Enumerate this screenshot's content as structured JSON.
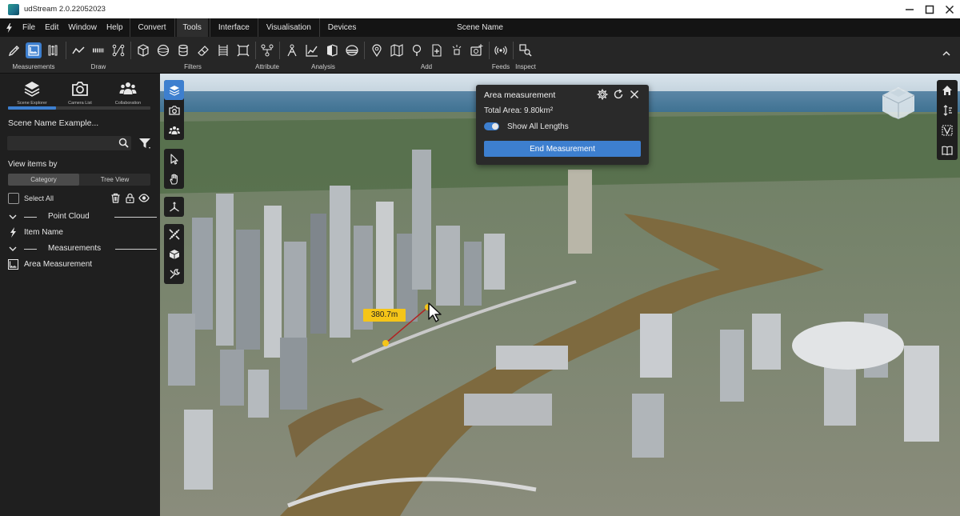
{
  "window": {
    "title": "udStream 2.0.22052023",
    "controls": [
      "minimize-icon",
      "maximize-icon",
      "close-icon"
    ]
  },
  "menubar": {
    "items": [
      "File",
      "Edit",
      "Window",
      "Help"
    ],
    "tabs": [
      "Convert",
      "Tools",
      "Interface",
      "Visualisation",
      "Devices"
    ],
    "active_tab": "Tools",
    "scene_name": "Scene Name"
  },
  "toolbar": {
    "groups": [
      {
        "label": "Measurements",
        "icons": [
          "ruler-pencil-icon",
          "area-measure-icon",
          "height-measure-icon"
        ]
      },
      {
        "label": "Draw",
        "icons": [
          "polyline-icon",
          "dashed-line-icon",
          "node-link-icon"
        ]
      },
      {
        "label": "Filters",
        "icons": [
          "box-filter-icon",
          "sphere-filter-icon",
          "cylinder-filter-icon",
          "eraser-icon",
          "cross-section-icon",
          "cube-select-icon"
        ]
      },
      {
        "label": "Attribute",
        "icons": [
          "attribute-tree-icon"
        ]
      },
      {
        "label": "Analysis",
        "icons": [
          "line-of-sight-icon",
          "chart-icon",
          "viewshed-icon",
          "flood-icon"
        ]
      },
      {
        "label": "Add",
        "icons": [
          "pin-icon",
          "map-icon",
          "poi-icon",
          "add-file-icon",
          "lamp-icon",
          "add-image-icon"
        ]
      },
      {
        "label": "Feeds",
        "icons": [
          "broadcast-icon"
        ]
      },
      {
        "label": "Inspect",
        "icons": [
          "inspect-icon"
        ]
      }
    ]
  },
  "sidebar": {
    "tabs": [
      {
        "label": "Scene Explorer",
        "icon": "layers-icon",
        "active": true
      },
      {
        "label": "Camera List",
        "icon": "camera-icon",
        "active": false
      },
      {
        "label": "Collaboration",
        "icon": "users-icon",
        "active": false
      }
    ],
    "scene_title": "Scene Name Example...",
    "search_placeholder": "",
    "view_by_label": "View items by",
    "view_modes": [
      "Category",
      "Tree View"
    ],
    "active_view_mode": "Category",
    "select_all_label": "Select All",
    "tree": [
      {
        "type": "group",
        "label": "Point Cloud"
      },
      {
        "type": "item",
        "label": "Item Name",
        "icon": "pointcloud-icon"
      },
      {
        "type": "group",
        "label": "Measurements"
      },
      {
        "type": "item",
        "label": "Area Measurement",
        "icon": "area-measure-icon"
      }
    ]
  },
  "viewport": {
    "left_tools": [
      "layers-icon",
      "camera-icon",
      "users-icon",
      "pointer-icon",
      "hand-icon",
      "gizmo-icon",
      "measure-tools-icon",
      "cube-icon",
      "tools-icon"
    ],
    "active_left_tool": "layers-icon",
    "right_tools": [
      "home-icon",
      "vertical-arrows-icon",
      "split-view-icon",
      "book-icon"
    ],
    "measurement_label": "380.7m"
  },
  "panel": {
    "title": "Area measurement",
    "total_area": "Total Area: 9.80km²",
    "toggle_label": "Show All Lengths",
    "toggle_on": true,
    "button_label": "End Measurement"
  },
  "colors": {
    "accent": "#3d7fcf",
    "measurement_label": "#f5c518",
    "background": "#1f1f1f"
  }
}
